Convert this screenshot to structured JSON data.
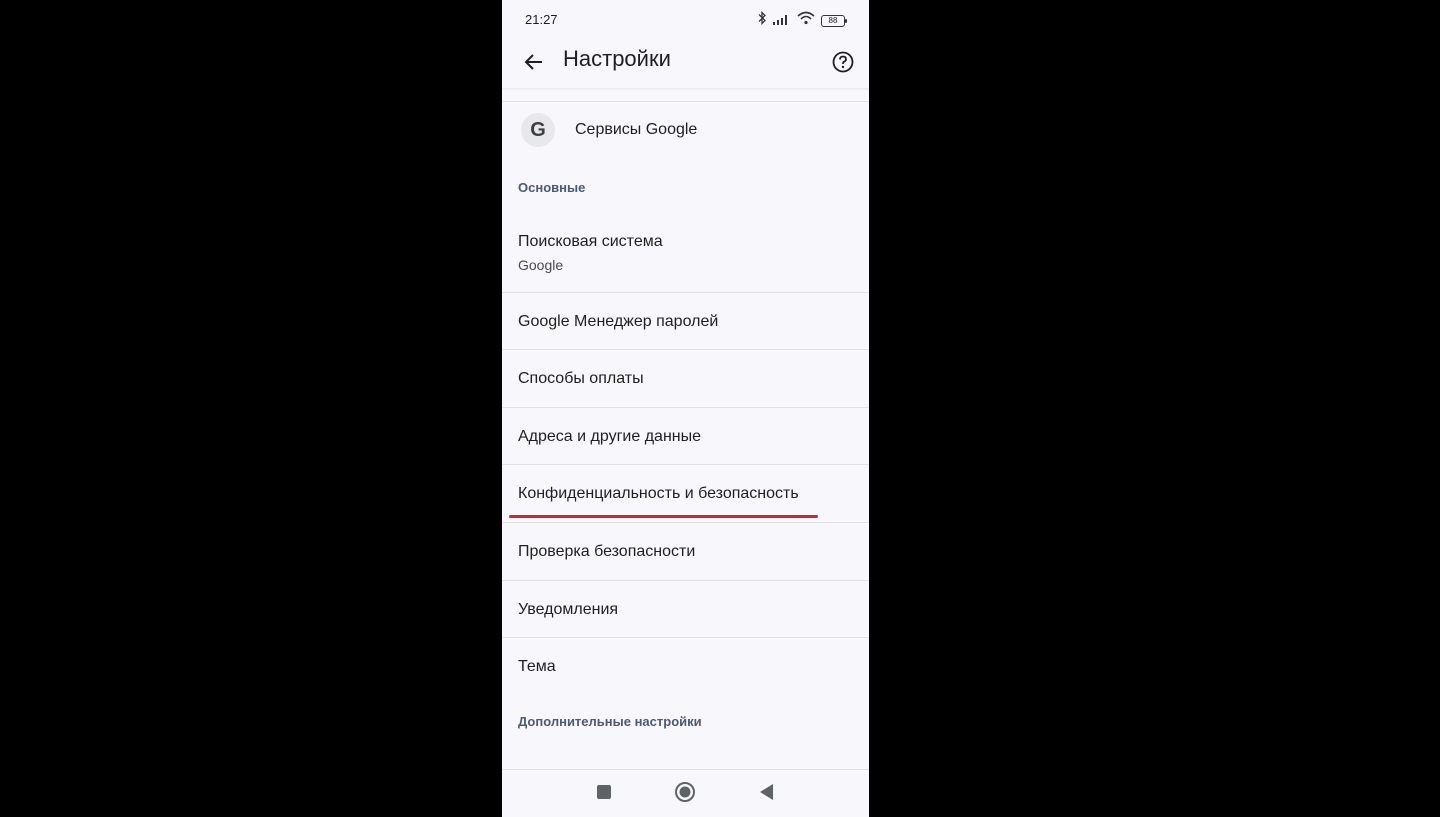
{
  "status_bar": {
    "time": "21:27",
    "battery": "88",
    "icons": [
      "bluetooth-icon",
      "signal-icon",
      "wifi-icon",
      "battery-icon"
    ]
  },
  "app_bar": {
    "title": "Настройки",
    "back_icon": "arrow-back-icon",
    "help_icon": "help-circle-icon"
  },
  "google_services": {
    "icon_letter": "G",
    "label": "Сервисы Google"
  },
  "sections": {
    "basic": "Основные",
    "advanced": "Дополнительные настройки"
  },
  "items": [
    {
      "title": "Поисковая система",
      "subtitle": "Google"
    },
    {
      "title": "Google Менеджер паролей"
    },
    {
      "title": "Способы оплаты"
    },
    {
      "title": "Адреса и другие данные"
    },
    {
      "title": "Конфиденциальность и безопасность"
    },
    {
      "title": "Проверка безопасности"
    },
    {
      "title": "Уведомления"
    },
    {
      "title": "Тема"
    }
  ],
  "annotation": {
    "highlight_color": "#c8283c"
  },
  "nav_bar": {
    "icons": [
      "recents-square-icon",
      "home-circle-icon",
      "back-triangle-icon"
    ]
  },
  "colors": {
    "background": "#f8f7fb",
    "section_header": "#4a5a74",
    "text": "#1f1f1f"
  }
}
